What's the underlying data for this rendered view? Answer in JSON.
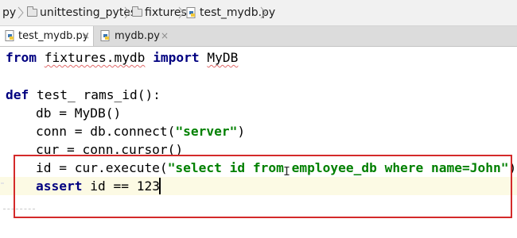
{
  "breadcrumb": {
    "items": [
      "py",
      "unittesting_pytest",
      "fixtures",
      "test_mydb.py"
    ]
  },
  "tabs": [
    {
      "label": "test_mydb.py",
      "active": true,
      "close": "×"
    },
    {
      "label": "mydb.py",
      "active": false,
      "close": "×"
    }
  ],
  "editor": {
    "lines": {
      "l1": {
        "kw1": "from",
        "module": "fixtures.mydb",
        "kw2": "import",
        "name": "MyDB"
      },
      "l3": {
        "kw": "def",
        "rest": "test_ rams_id():"
      },
      "l4": "db = MyDB()",
      "l5": {
        "pre": "conn = db.connect(",
        "str": "\"server\"",
        "post": ")"
      },
      "l6": "cur = conn.cursor()",
      "l7": {
        "pre": "id = cur.execute(",
        "str": "\"select id from employee_db where name=John\"",
        "post": ")"
      },
      "l8": {
        "kw": "assert",
        "rest": " id == 123"
      }
    }
  },
  "colors": {
    "keyword": "#000080",
    "string": "#008000",
    "highlight_border": "#d42a2a",
    "current_line": "#fcfae4"
  }
}
